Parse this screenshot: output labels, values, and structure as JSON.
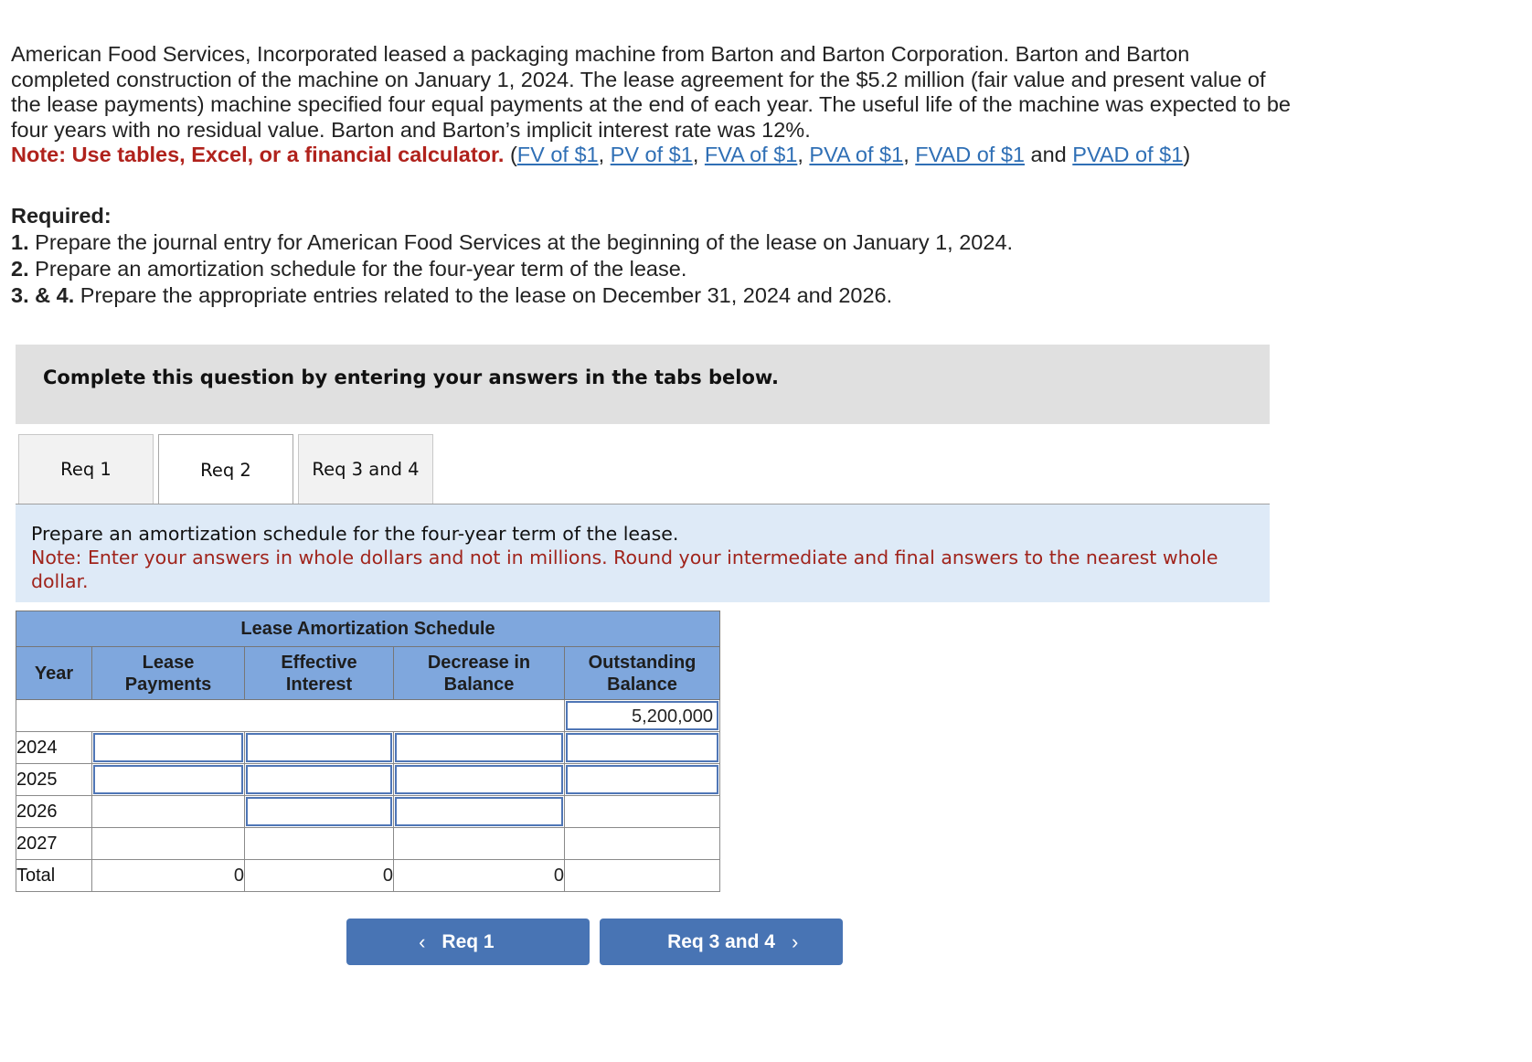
{
  "problem": {
    "text_lines": [
      "American Food Services, Incorporated leased a packaging machine from Barton and Barton Corporation. Barton and Barton",
      "completed construction of the machine on January 1, 2024. The lease agreement for the $5.2 million (fair value and present value of",
      "the lease payments) machine specified four equal payments at the end of each year. The useful life of the machine was expected to be",
      "four years with no residual value. Barton and Barton’s implicit interest rate was 12%."
    ],
    "note_label": "Note: Use tables, Excel, or a financial calculator.",
    "links": {
      "open_paren": "(",
      "fv": "FV of $1",
      "pv": "PV of $1",
      "fva": "FVA of $1",
      "pva": "PVA of $1",
      "fvad": "FVAD of $1",
      "and": "and",
      "pvad": "PVAD of $1",
      "close_paren": ")",
      "sep": ", "
    }
  },
  "required": {
    "title": "Required:",
    "items": [
      {
        "num": "1.",
        "text": "Prepare the journal entry for American Food Services at the beginning of the lease on January 1, 2024."
      },
      {
        "num": "2.",
        "text": "Prepare an amortization schedule for the four-year term of the lease."
      },
      {
        "num": "3. & 4.",
        "text": "Prepare the appropriate entries related to the lease on December 31, 2024 and 2026."
      }
    ]
  },
  "banner": "Complete this question by entering your answers in the tabs below.",
  "tabs": [
    {
      "label": "Req 1",
      "active": false
    },
    {
      "label": "Req 2",
      "active": true
    },
    {
      "label": "Req 3 and 4",
      "active": false
    }
  ],
  "instruction": {
    "text": "Prepare an amortization schedule for the four-year term of the lease.",
    "note": "Note: Enter your answers in whole dollars and not in millions. Round your intermediate and final answers to the nearest whole dollar."
  },
  "schedule": {
    "title": "Lease Amortization Schedule",
    "columns": [
      "Year",
      "Lease Payments",
      "Effective Interest",
      "Decrease in Balance",
      "Outstanding Balance"
    ],
    "initial_balance": "5,200,000",
    "rows": [
      {
        "year": "2024",
        "payment": "",
        "interest": "",
        "decrease": "",
        "balance": ""
      },
      {
        "year": "2025",
        "payment": "",
        "interest": "",
        "decrease": "",
        "balance": ""
      },
      {
        "year": "2026",
        "payment": "",
        "interest": "",
        "decrease": "",
        "balance": ""
      },
      {
        "year": "2027",
        "payment": "",
        "interest": "",
        "decrease": "",
        "balance": ""
      }
    ],
    "total": {
      "label": "Total",
      "payment": "0",
      "interest": "0",
      "decrease": "0"
    }
  },
  "nav": {
    "prev_label": "Req 1",
    "next_label": "Req 3 and 4",
    "prev_icon": "‹",
    "next_icon": "›"
  },
  "colors": {
    "accent_blue": "#4874b4",
    "header_blue": "#7fa7dd",
    "note_red": "#b0221c",
    "link_blue": "#2f6fb5",
    "instruction_bg": "#deeaf7"
  }
}
